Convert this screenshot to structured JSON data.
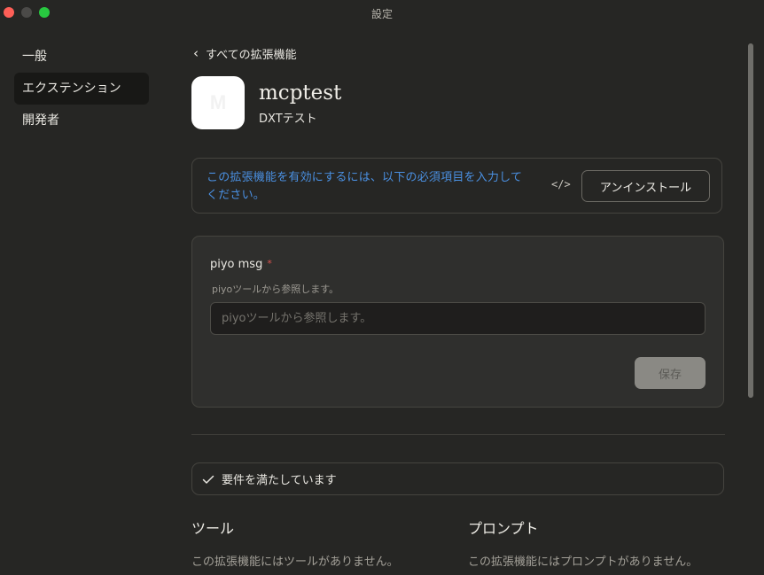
{
  "window": {
    "title": "設定"
  },
  "sidebar": {
    "items": [
      {
        "label": "一般"
      },
      {
        "label": "エクステンション"
      },
      {
        "label": "開発者"
      }
    ]
  },
  "header": {
    "back_label": "すべての拡張機能",
    "ext_name": "mcptest",
    "ext_subtitle": "DXTテスト",
    "logo_letter": "M"
  },
  "notice": {
    "message": "この拡張機能を有効にするには、以下の必須項目を入力してください。",
    "code_icon": "</>",
    "uninstall_label": "アンインストール"
  },
  "config": {
    "field_label": "piyo msg",
    "required_mark": "*",
    "help_text": "piyoツールから参照します。",
    "placeholder": "piyoツールから参照します。",
    "value": "",
    "save_label": "保存"
  },
  "requirements": {
    "status": "要件を満たしています"
  },
  "tools": {
    "title": "ツール",
    "empty": "この拡張機能にはツールがありません。"
  },
  "prompts": {
    "title": "プロンプト",
    "empty": "この拡張機能にはプロンプトがありません。"
  },
  "colors": {
    "background": "#262624",
    "accent_link": "#4a90e2",
    "required": "#d9534f",
    "save_button": "#8a8984"
  }
}
